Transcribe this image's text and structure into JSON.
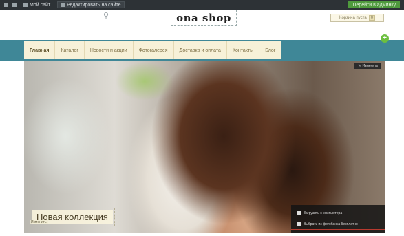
{
  "adminbar": {
    "item1": "Мой сайт",
    "item2": "Редактировать на сайте",
    "right": "Перейти в админку"
  },
  "header": {
    "logo": "ona shop",
    "cart": "Корзина пуста",
    "cart_count": "0"
  },
  "nav": {
    "items": [
      "Главная",
      "Каталог",
      "Новости и акции",
      "Фотогалерея",
      "Доставка и оплата",
      "Контакты",
      "Блог"
    ],
    "active_index": 0
  },
  "hero": {
    "corner_button": "Изменить",
    "caption": "Новая коллекция",
    "small_tag": "Изменить",
    "panel": {
      "row1": "Загрузить с компьютера",
      "row2": "Выбрать из фотобанка бесплатно"
    }
  },
  "colors": {
    "nav_bg": "#3f8797",
    "nav_inner_bg": "#f7f1d8",
    "admin_bg": "#2d3236",
    "accent_green": "#6cbf3f"
  }
}
